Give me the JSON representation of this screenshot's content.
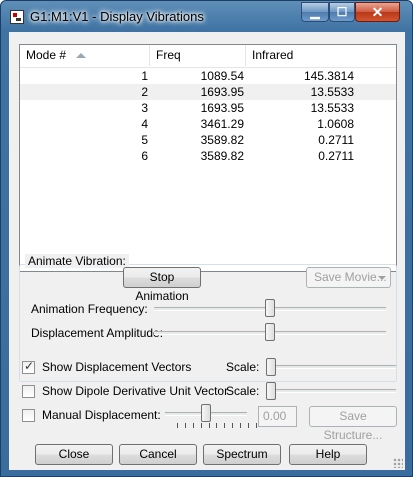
{
  "window": {
    "title": "G1:M1:V1 - Display Vibrations"
  },
  "title_buttons": {
    "minimize": "▁",
    "maximize": "☐",
    "close": "✕"
  },
  "table": {
    "columns": [
      "Mode #",
      "Freq",
      "Infrared"
    ],
    "rows": [
      {
        "mode": "1",
        "freq": "1089.54",
        "ir": "145.3814"
      },
      {
        "mode": "2",
        "freq": "1693.95",
        "ir": "13.5533"
      },
      {
        "mode": "3",
        "freq": "1693.95",
        "ir": "13.5533"
      },
      {
        "mode": "4",
        "freq": "3461.29",
        "ir": "1.0608"
      },
      {
        "mode": "5",
        "freq": "3589.82",
        "ir": "0.2711"
      },
      {
        "mode": "6",
        "freq": "3589.82",
        "ir": "0.2711"
      }
    ],
    "selected_row": 2
  },
  "animate": {
    "group_label": "Animate Vibration:",
    "stop_button": "Stop Animation",
    "save_movie_button": "Save Movie...",
    "frequency_label": "Animation Frequency:",
    "frequency_value": 0.5,
    "amplitude_label": "Displacement Amplitude:",
    "amplitude_value": 0.5
  },
  "options": {
    "show_vectors": {
      "label": "Show Displacement Vectors",
      "checked": true,
      "scale_label": "Scale:",
      "scale_value": 0.02
    },
    "show_dipole": {
      "label": "Show Dipole Derivative Unit Vector",
      "checked": false,
      "scale_label": "Scale:",
      "scale_value": 0.02
    },
    "manual": {
      "label": "Manual Displacement:",
      "checked": false,
      "value": "0.00",
      "save_structure_button": "Save Structure..."
    }
  },
  "footer": {
    "close": "Close",
    "cancel": "Cancel",
    "spectrum": "Spectrum",
    "help": "Help"
  },
  "icons": [
    "app-icon",
    "sort-ascending-icon",
    "dropdown-arrow-icon",
    "checkmark-icon",
    "resize-grip-icon"
  ]
}
